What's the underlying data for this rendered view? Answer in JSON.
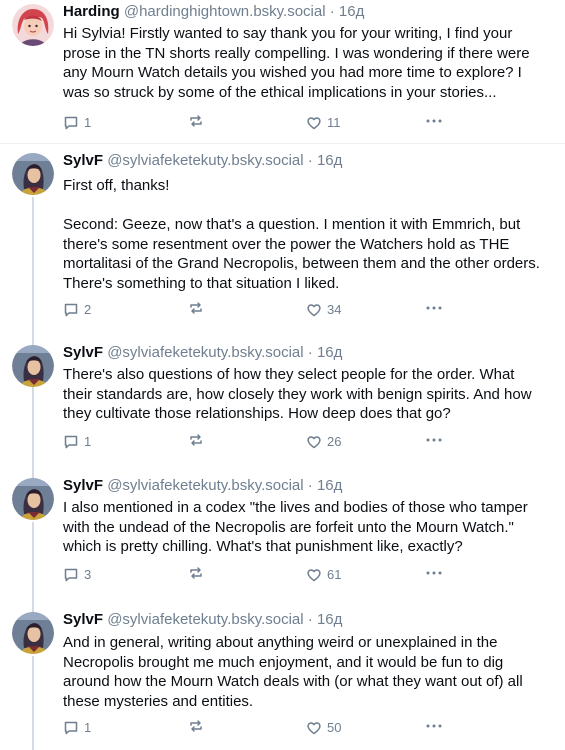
{
  "posts": [
    {
      "author": "Harding",
      "handle": "@hardinghightown.bsky.social",
      "time": "16д",
      "text": "Hi Sylvia! Firstly wanted to say thank you for your writing, I find your prose in the TN shorts really compelling. I was wondering if there were any Mourn Watch details you wished you had more time to explore? I was so struck by some of the ethical implications in your stories...",
      "replies": "1",
      "reposts": "",
      "likes": "11"
    },
    {
      "author": "SylvF",
      "handle": "@sylviafeketekuty.bsky.social",
      "time": "16д",
      "text": "First off, thanks!\n\nSecond: Geeze, now that's a question. I mention it with Emmrich, but there's some resentment over the power the Watchers hold as THE mortalitasi of the Grand Necropolis, between them and the other orders. There's something to that situation I liked.",
      "replies": "2",
      "reposts": "",
      "likes": "34"
    },
    {
      "author": "SylvF",
      "handle": "@sylviafeketekuty.bsky.social",
      "time": "16д",
      "text": "There's also questions of how they select people for the order. What their standards are, how closely they work with benign spirits. And how they cultivate those relationships. How deep does that go?",
      "replies": "1",
      "reposts": "",
      "likes": "26"
    },
    {
      "author": "SylvF",
      "handle": "@sylviafeketekuty.bsky.social",
      "time": "16д",
      "text": "I also mentioned in a codex \"the lives and bodies of those who tamper with the undead of the Necropolis are forfeit unto the Mourn Watch.\" which is pretty chilling. What's that punishment like, exactly?",
      "replies": "3",
      "reposts": "",
      "likes": "61"
    },
    {
      "author": "SylvF",
      "handle": "@sylviafeketekuty.bsky.social",
      "time": "16д",
      "text": "And in general, writing about anything weird or unexplained in the Necropolis brought me much enjoyment, and it would be fun to dig around how the Mourn Watch deals with (or what they want out of) all these mysteries and entities.",
      "replies": "1",
      "reposts": "",
      "likes": "50"
    }
  ],
  "separator": "·",
  "icons": {
    "reply": "speech-bubble-icon",
    "repost": "repost-arrows-icon",
    "like": "heart-icon",
    "more": "ellipsis-icon",
    "avatar_harding": "pink-hair-cartoon-avatar",
    "avatar_sylvf": "illustrated-character-avatar"
  },
  "colors": {
    "text": "#0b0f14",
    "muted": "#6f7f8f",
    "thread_line": "#d4dbe2",
    "divider": "#eef1f4"
  }
}
